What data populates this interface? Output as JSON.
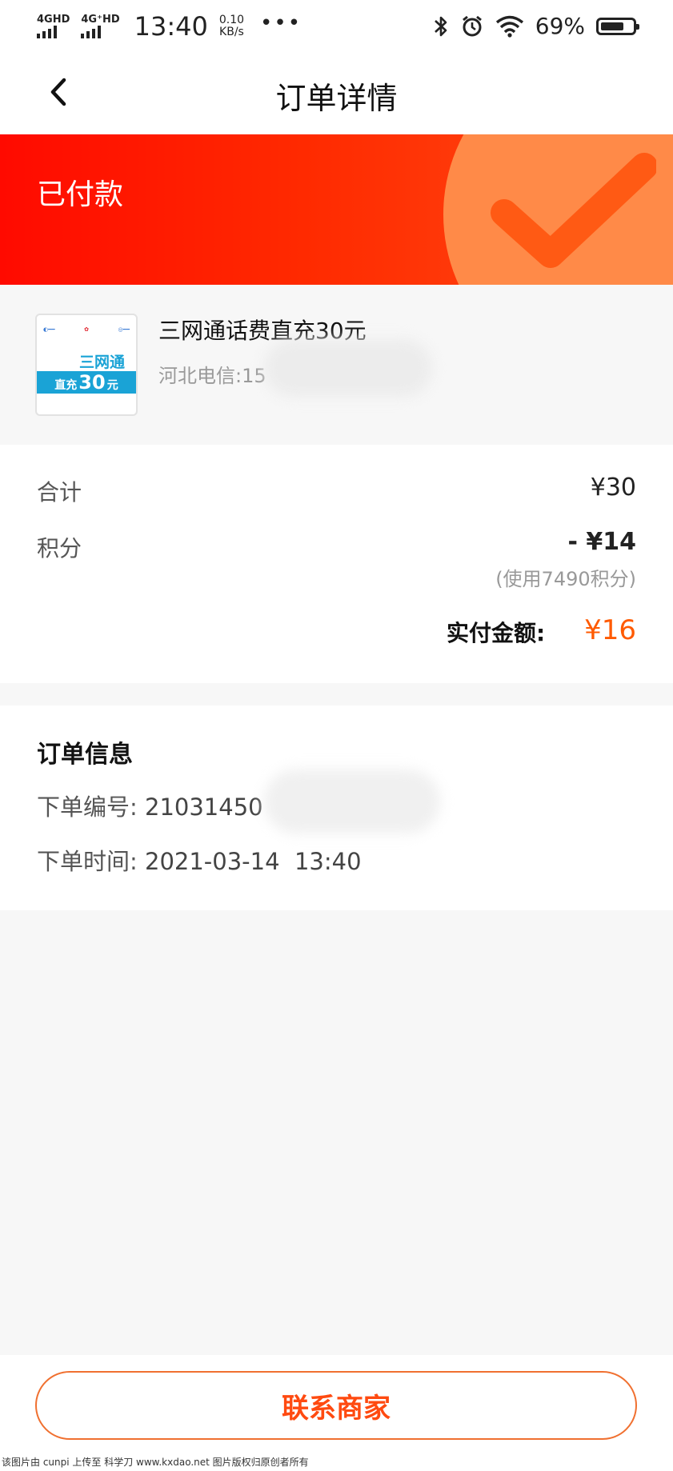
{
  "status_bar": {
    "signal1_label": "4GHD",
    "signal2_label": "4G⁺HD",
    "time": "13:40",
    "speed_value": "0.10",
    "speed_unit": "KB/s",
    "more": "•••",
    "battery_percent": "69%"
  },
  "nav": {
    "title": "订单详情"
  },
  "banner": {
    "status": "已付款"
  },
  "product": {
    "thumb_line": "三网通",
    "thumb_band_prefix": "直充",
    "thumb_band_amount": "30",
    "thumb_band_suffix": "元",
    "name": "三网通话费直充30元",
    "subtitle": "河北电信:15"
  },
  "amounts": {
    "total_label": "合计",
    "total_value": "¥30",
    "points_label": "积分",
    "points_value": "- ¥14",
    "points_note": "(使用7490积分)",
    "paid_label": "实付金额:",
    "paid_value": "¥16"
  },
  "order_info": {
    "title": "订单信息",
    "number_label": "下单编号:",
    "number_value": "21031450",
    "time_label": "下单时间:",
    "time_value": "2021-03-14  13:40"
  },
  "actions": {
    "contact_label": "联系商家"
  },
  "footer": {
    "note": "该图片由 cunpi 上传至 科学刀 www.kxdao.net 图片版权归原创者所有"
  },
  "colors": {
    "accent": "#ff4a10",
    "banner_red": "#ff0a00",
    "paid_orange": "#ff5a00"
  }
}
